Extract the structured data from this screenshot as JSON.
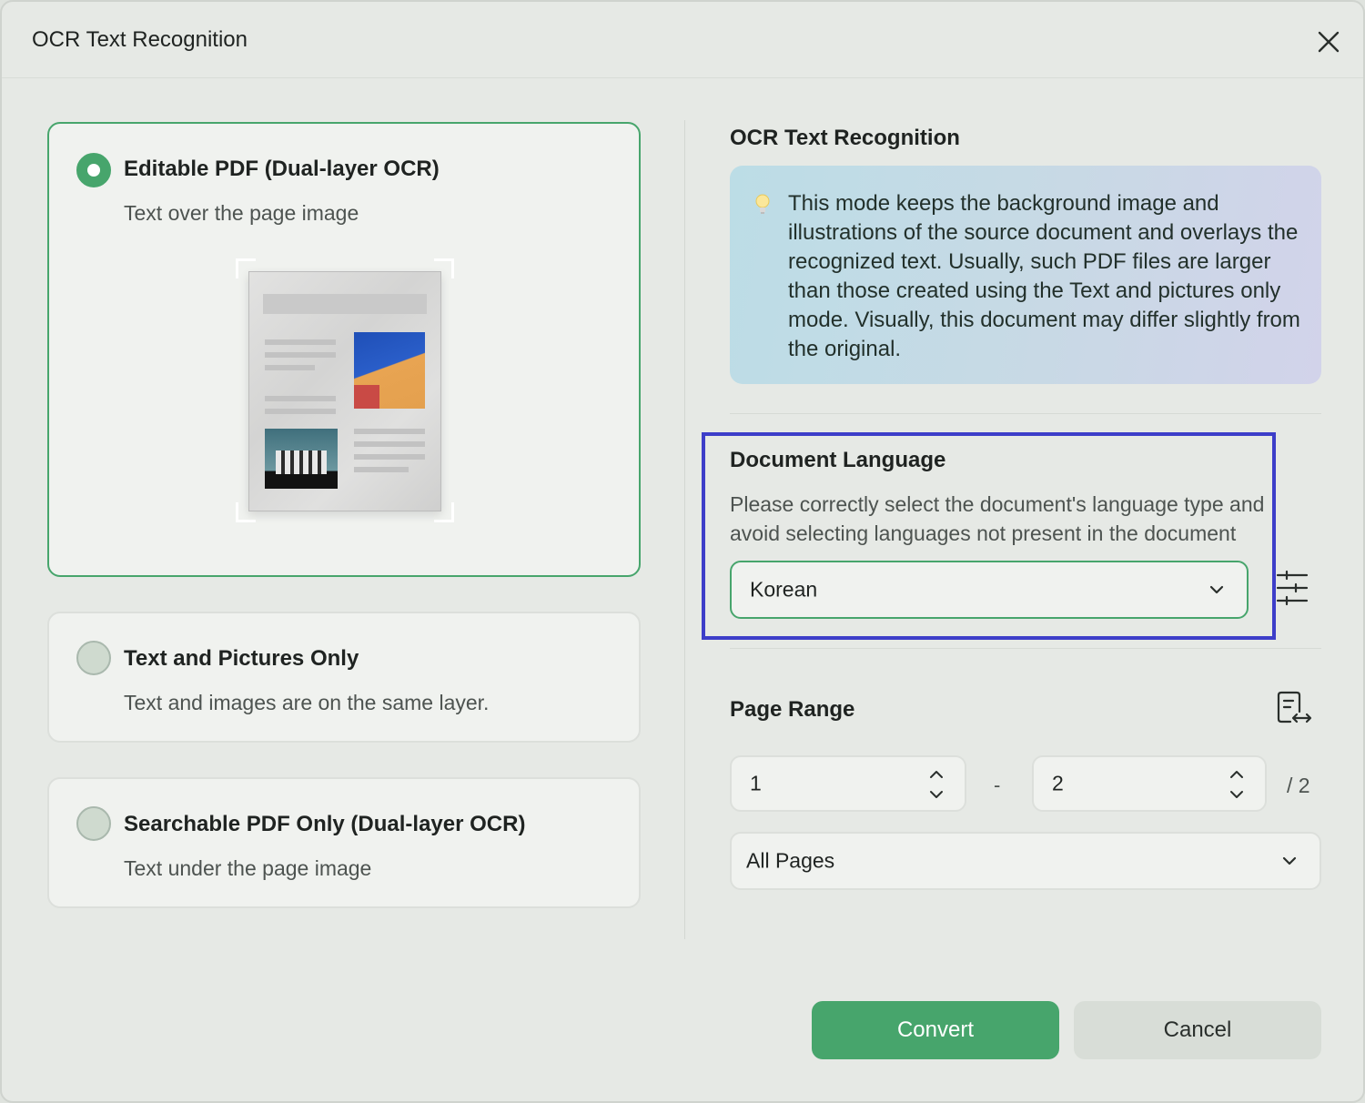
{
  "window": {
    "title": "OCR Text Recognition"
  },
  "modes": [
    {
      "title": "Editable PDF (Dual-layer OCR)",
      "subtitle": "Text over the page image",
      "selected": true
    },
    {
      "title": "Text and Pictures Only",
      "subtitle": "Text and images are on the same layer.",
      "selected": false
    },
    {
      "title": "Searchable PDF Only (Dual-layer OCR)",
      "subtitle": "Text under the page image",
      "selected": false
    }
  ],
  "right": {
    "ocr_title": "OCR Text Recognition",
    "info_text": "This mode keeps the background image and illustrations of the source document and overlays the recognized text. Usually, such PDF files are larger than those created using the Text and pictures only mode. Visually, this document may differ slightly from the original.",
    "language": {
      "title": "Document Language",
      "description_line1": "Please correctly select the document's language type and",
      "description_line2": "avoid selecting languages not present in the document",
      "selected": "Korean"
    },
    "page_range": {
      "title": "Page Range",
      "from": "1",
      "separator": "-",
      "to": "2",
      "total": "/ 2",
      "preset": "All Pages"
    }
  },
  "buttons": {
    "convert": "Convert",
    "cancel": "Cancel"
  },
  "colors": {
    "accent": "#47a56c",
    "highlight": "#3d3ec9"
  },
  "icons": [
    "close-icon",
    "lightbulb-icon",
    "settings-sliders-icon",
    "page-swap-icon",
    "chevron-down-icon",
    "spinner-arrows-icon"
  ]
}
